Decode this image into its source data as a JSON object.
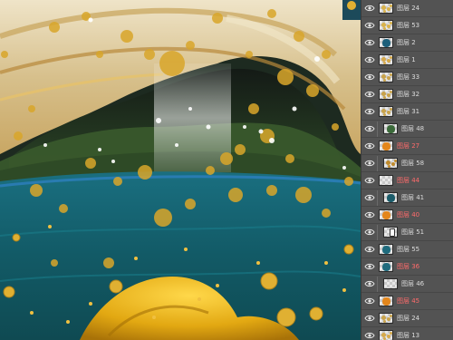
{
  "layers_panel": {
    "layers": [
      {
        "name": "图层 24",
        "thumb_color": "#d9b24a",
        "thumb_style": "gold"
      },
      {
        "name": "图层 53",
        "thumb_color": "#d9b24a",
        "thumb_style": "gold"
      },
      {
        "name": "图层 2",
        "thumb_color": "#1c5f7a",
        "thumb_style": "blue"
      },
      {
        "name": "图层 1",
        "thumb_color": "#d6a94a",
        "thumb_style": "gold"
      },
      {
        "name": "图层 33",
        "thumb_color": "#c9a34a",
        "thumb_style": "gold"
      },
      {
        "name": "图层 32",
        "thumb_color": "#c9a34a",
        "thumb_style": "gold"
      },
      {
        "name": "图层 31",
        "thumb_color": "#c9a34a",
        "thumb_style": "gold"
      },
      {
        "name": "图层 48",
        "thumb_color": "#3b6a3a",
        "thumb_style": "green",
        "indented": true
      },
      {
        "name": "图层 27",
        "thumb_color": "#e3861c",
        "thumb_style": "orange",
        "label_red": true
      },
      {
        "name": "图层 58",
        "thumb_color": "#c08a2a",
        "thumb_style": "gold",
        "indented": true
      },
      {
        "name": "图层 44",
        "thumb_color": "#c9c9c9",
        "thumb_style": "plain",
        "label_red": true
      },
      {
        "name": "图层 41",
        "thumb_color": "#1b5c6a",
        "thumb_style": "teal",
        "indented": true
      },
      {
        "name": "图层 40",
        "thumb_color": "#e3861c",
        "thumb_style": "orange",
        "label_red": true
      },
      {
        "name": "图层 51",
        "thumb_color": "#ffffff",
        "thumb_style": "white",
        "indented": true
      },
      {
        "name": "图层 55",
        "thumb_color": "#1f6b7d",
        "thumb_style": "teal"
      },
      {
        "name": "图层 36",
        "thumb_color": "#1f6b7d",
        "thumb_style": "teal",
        "label_red": true
      },
      {
        "name": "图层 46",
        "thumb_color": "#e8e8e8",
        "thumb_style": "plain",
        "indented": true
      },
      {
        "name": "图层 45",
        "thumb_color": "#e3861c",
        "thumb_style": "orange",
        "label_red": true
      },
      {
        "name": "图层 24",
        "thumb_color": "#c9a34a",
        "thumb_style": "gold"
      },
      {
        "name": "图层 13",
        "thumb_color": "#d6a94a",
        "thumb_style": "gold"
      }
    ]
  },
  "colors": {
    "panel_bg": "#535353",
    "rock": "#d8c8a0",
    "gold": "#d9a62a",
    "teal": "#1f6f7a",
    "dark_green": "#2e4a2a",
    "yellow_cloth": "#e8b81c"
  },
  "icons": {
    "visibility": "eye-icon"
  }
}
